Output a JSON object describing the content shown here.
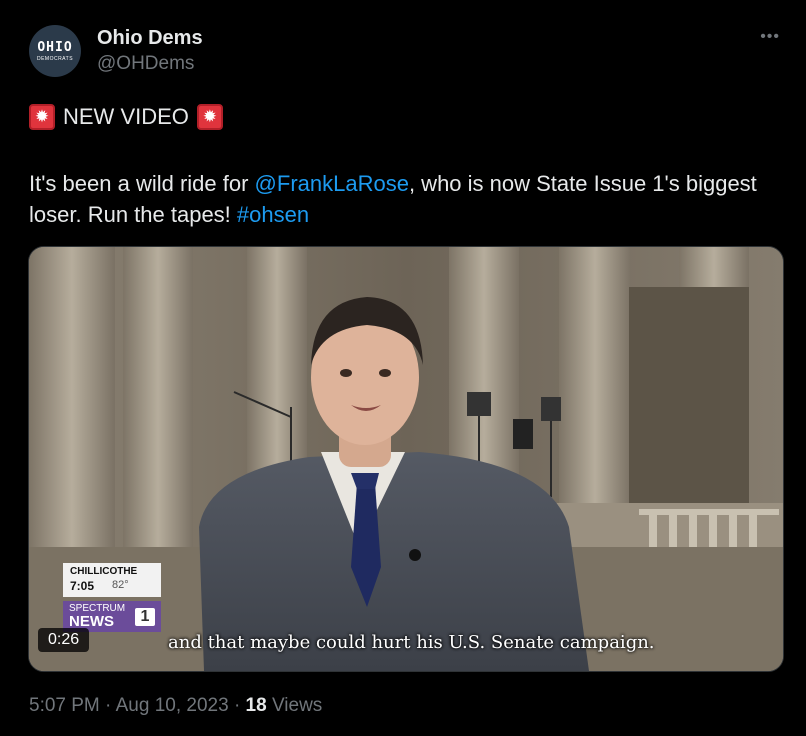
{
  "author": {
    "name": "Ohio Dems",
    "handle": "@OHDems",
    "avatar_line1": "OHIO",
    "avatar_line2": "DEMOCRATS"
  },
  "more_icon": "more-icon",
  "tweet": {
    "headline": "NEW VIDEO",
    "text_before": "It's been a wild ride for ",
    "mention": "@FrankLaRose",
    "text_middle": ", who is now State Issue 1's biggest loser. Run the tapes! ",
    "hashtag": "#ohsen"
  },
  "video": {
    "timestamp": "0:26",
    "caption": "and that maybe could hurt his U.S. Senate campaign.",
    "bug": {
      "location": "CHILLICOTHE",
      "time": "7:05",
      "temp": "82°",
      "brand_line1": "SPECTRUM",
      "brand_line2": "NEWS",
      "channel": "1"
    }
  },
  "meta": {
    "time": "5:07 PM",
    "separator": "·",
    "date": "Aug 10, 2023",
    "views_count": "18",
    "views_label": "Views"
  },
  "colors": {
    "background": "#000000",
    "link": "#1d9bf0",
    "muted": "#71767b",
    "siren": "#e0343d"
  }
}
